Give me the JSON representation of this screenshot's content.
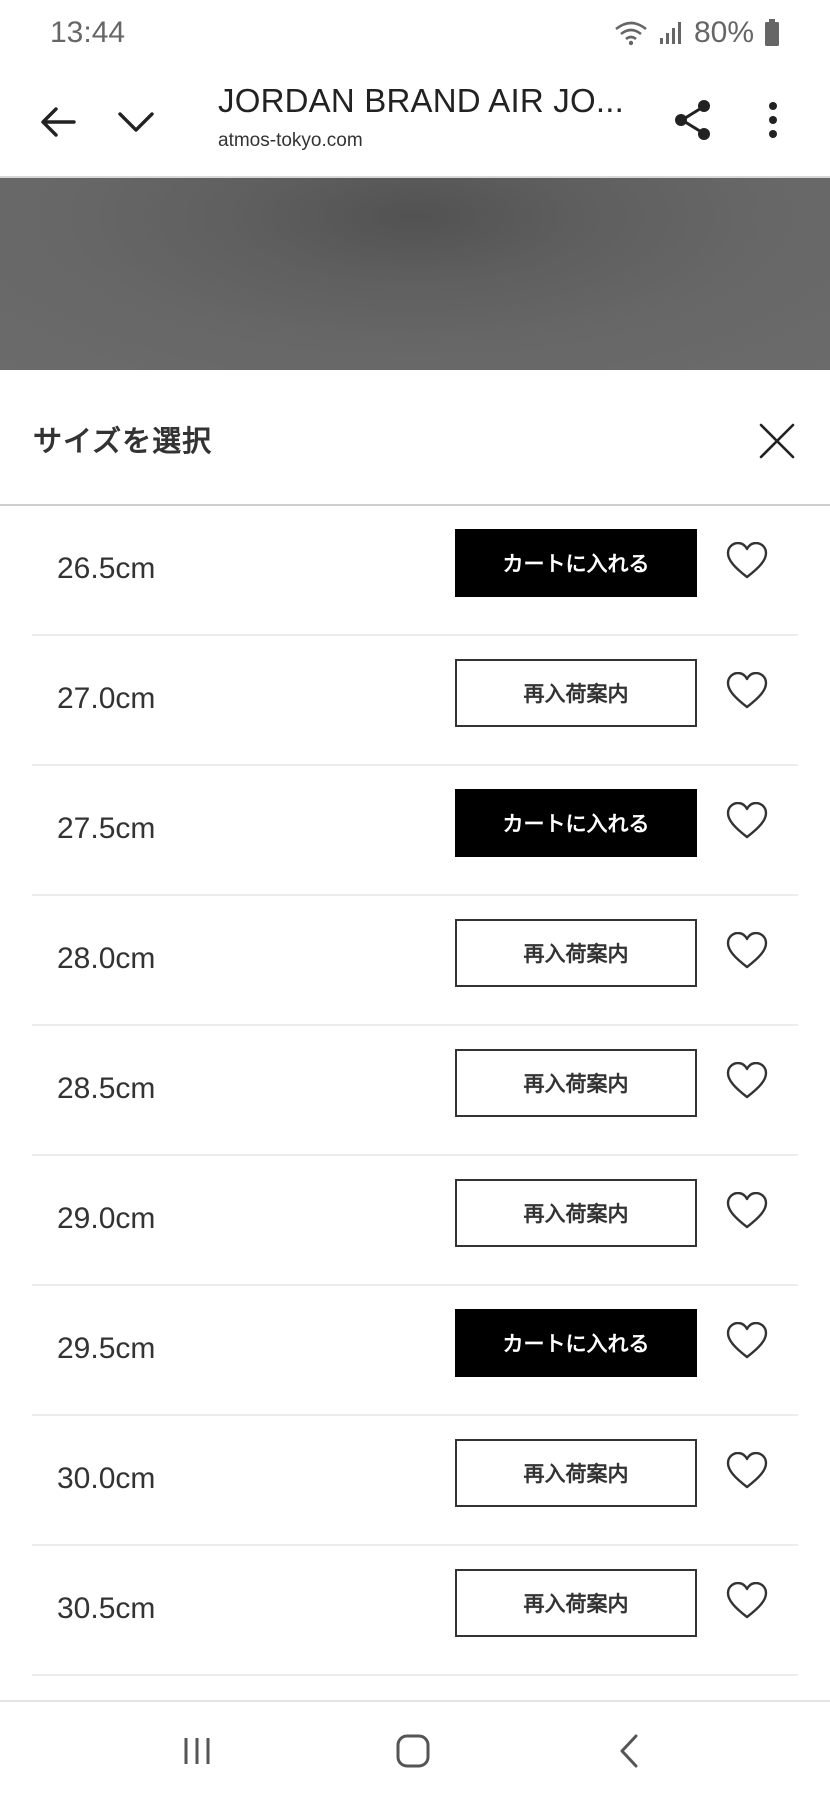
{
  "status_bar": {
    "time": "13:44",
    "battery": "80%"
  },
  "app_bar": {
    "title": "JORDAN BRAND AIR JO...",
    "url": "atmos-tokyo.com",
    "icons": {
      "back": "arrow-left",
      "collapse": "chevron-down",
      "share": "share",
      "more": "more-vertical"
    }
  },
  "sheet": {
    "title": "サイズを選択",
    "sizes": [
      {
        "size": "26.5cm",
        "action": "カートに入れる",
        "type": "cart"
      },
      {
        "size": "27.0cm",
        "action": "再入荷案内",
        "type": "notify"
      },
      {
        "size": "27.5cm",
        "action": "カートに入れる",
        "type": "cart"
      },
      {
        "size": "28.0cm",
        "action": "再入荷案内",
        "type": "notify"
      },
      {
        "size": "28.5cm",
        "action": "再入荷案内",
        "type": "notify"
      },
      {
        "size": "29.0cm",
        "action": "再入荷案内",
        "type": "notify"
      },
      {
        "size": "29.5cm",
        "action": "カートに入れる",
        "type": "cart"
      },
      {
        "size": "30.0cm",
        "action": "再入荷案内",
        "type": "notify"
      },
      {
        "size": "30.5cm",
        "action": "再入荷案内",
        "type": "notify"
      }
    ]
  },
  "nav_bar": {
    "icons": [
      "recents",
      "home",
      "back"
    ]
  },
  "colors": {
    "primary_button": "#000000",
    "text": "#333333",
    "divider": "#ececec"
  }
}
